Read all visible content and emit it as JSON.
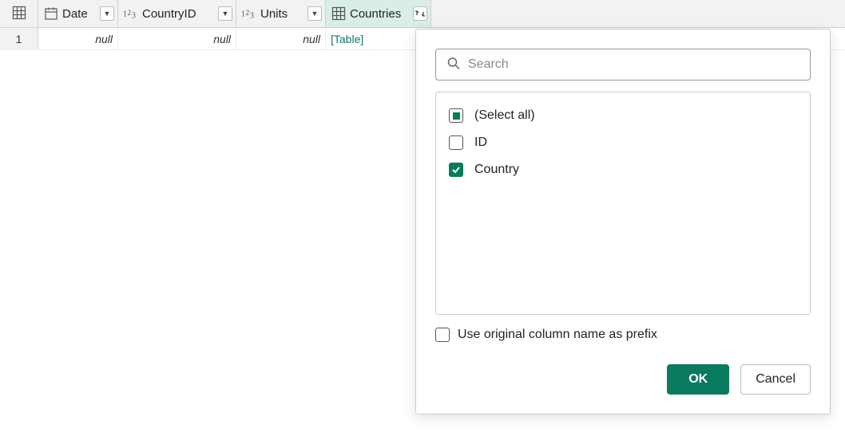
{
  "columns": [
    {
      "name": "Date",
      "type": "date"
    },
    {
      "name": "CountryID",
      "type": "number"
    },
    {
      "name": "Units",
      "type": "number"
    },
    {
      "name": "Countries",
      "type": "table"
    }
  ],
  "rows": [
    {
      "n": "1",
      "date": "null",
      "cid": "null",
      "units": "null",
      "ctry": "[Table]"
    }
  ],
  "expand_popup": {
    "search_placeholder": "Search",
    "items": [
      {
        "label": "(Select all)",
        "state": "indeterminate"
      },
      {
        "label": "ID",
        "state": "unchecked"
      },
      {
        "label": "Country",
        "state": "checked"
      }
    ],
    "prefix_label": "Use original column name as prefix",
    "prefix_checked": false,
    "ok_label": "OK",
    "cancel_label": "Cancel"
  },
  "colors": {
    "accent": "#0a7a5f",
    "header_bg": "#f2f2f2",
    "selected_col_bg": "#d9eee7"
  }
}
